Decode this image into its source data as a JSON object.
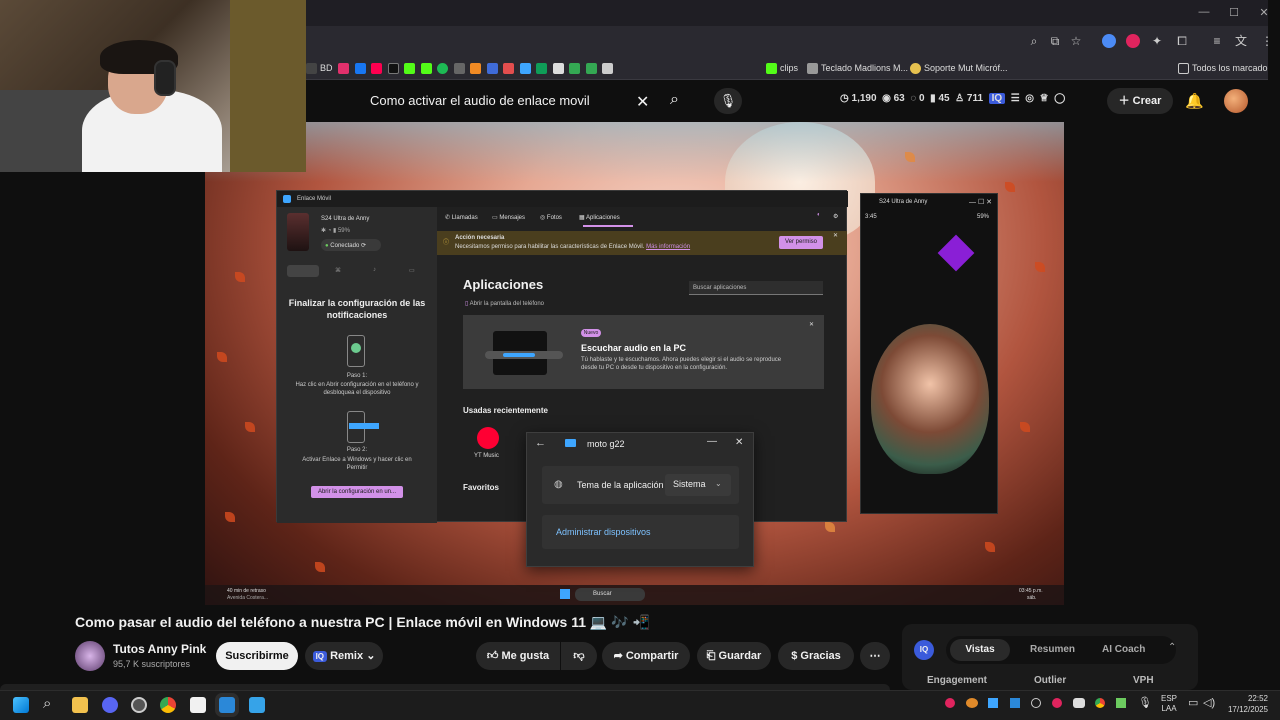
{
  "browser": {
    "bookmarks": [
      "BD",
      "clips",
      "Teclado Madlions M...",
      "Soporte Mut Micróf...",
      "Todos los marcadores"
    ]
  },
  "youtube": {
    "search_query": "Como activar el audio de enlace movil",
    "stats": {
      "views": "1,190",
      "a": "63",
      "b": "0",
      "c": "45",
      "subs": "711"
    },
    "create_label": "Crear",
    "video_title": "Como pasar el audio del teléfono a nuestra PC | Enlace móvil en Windows 11 💻 🎶 📲",
    "channel_name": "Tutos Anny Pink",
    "subscribers": "95,7 K suscriptores",
    "subscribe_label": "Suscribirme",
    "remix_label": "Remix",
    "like_label": "Me gusta",
    "share_label": "Compartir",
    "save_label": "Guardar",
    "thanks_label": "Gracias",
    "panel_tabs": [
      "Vistas",
      "Resumen",
      "AI Coach"
    ],
    "panel_cols": [
      "Engagement",
      "Outlier",
      "VPH"
    ]
  },
  "enlace": {
    "window_title": "Enlace Móvil",
    "device_name": "S24 Ultra de Anny",
    "battery": "59%",
    "status": "Conectado",
    "tabs": [
      "Llamadas",
      "Mensajes",
      "Fotos",
      "Aplicaciones"
    ],
    "alert_title": "Acción necesaria",
    "alert_text": "Necesitamos permiso para habilitar las características de Enlace Móvil.",
    "alert_link": "Más información",
    "alert_button": "Ver permiso",
    "section_title": "Aplicaciones",
    "search_placeholder": "Buscar aplicaciones",
    "open_screen": "Abrir la pantalla del teléfono",
    "new_badge": "Nuevo",
    "card_title": "Escuchar audio en la PC",
    "card_text": "Tú hablaste y te escuchamos. Ahora puedes elegir si el audio se reproduce desde tu PC o desde tu dispositivo en la configuración.",
    "recent_title": "Usadas recientemente",
    "recent_app": "YT Music",
    "favorites_title": "Favoritos",
    "side_heading": "Finalizar la configuración de las notificaciones",
    "step1_label": "Paso 1:",
    "step1_text": "Haz clic en Abrir configuración en el teléfono y desbloquea el dispositivo",
    "step2_label": "Paso 2:",
    "step2_text": "Activar Enlace a Windows y hacer clic en Permitir",
    "side_button": "Abrir la configuración en un..."
  },
  "phone_window": {
    "title": "S24 Ultra de Anny",
    "time": "3:45",
    "battery": "59%"
  },
  "dialog": {
    "title": "moto g22",
    "theme_label": "Tema de la aplicación",
    "theme_value": "Sistema",
    "manage_link": "Administrar dispositivos"
  },
  "video_taskbar": {
    "weather": "40 min de retraso",
    "weather_sub": "Avenida Costera...",
    "search": "Buscar",
    "time": "03:45 p.m.",
    "day": "sáb."
  },
  "taskbar": {
    "lang1": "ESP",
    "lang2": "LAA",
    "time": "22:52",
    "date": "17/12/2025"
  },
  "colors": {
    "accent": "#3ea6ff",
    "pink": "#d291e8",
    "youtube_red": "#ff0000"
  }
}
